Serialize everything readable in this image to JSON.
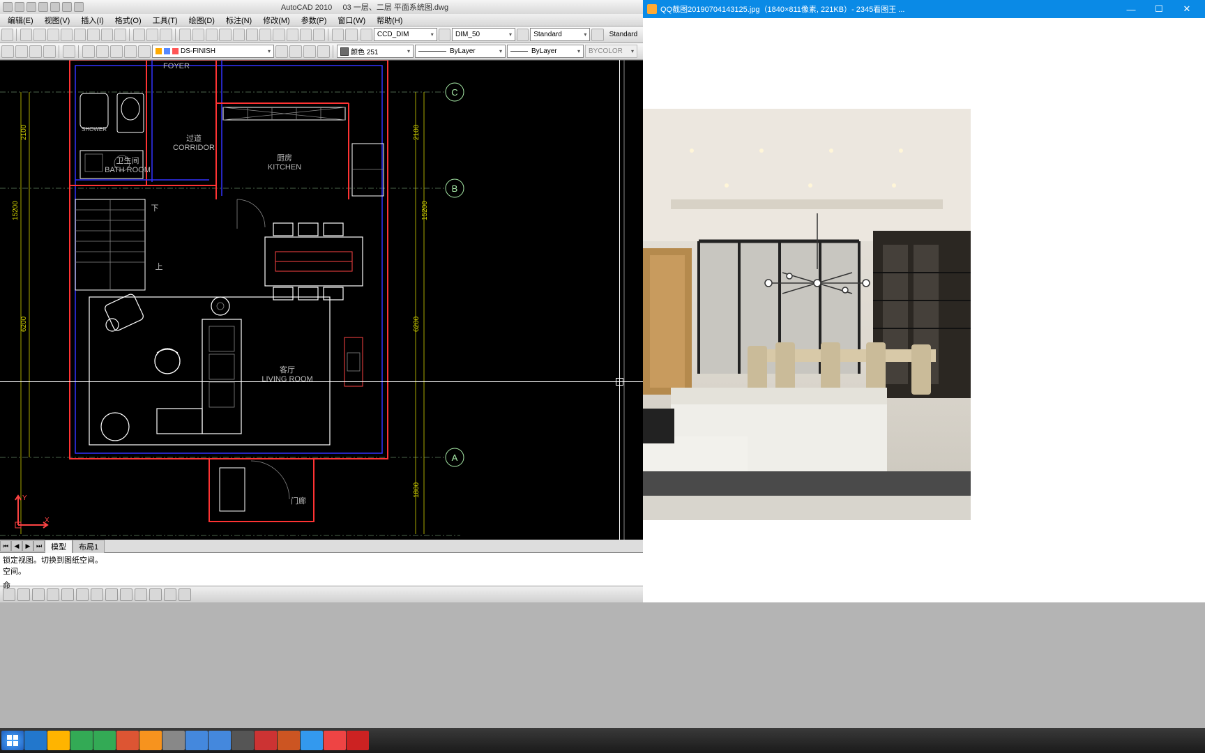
{
  "acad": {
    "app_name": "AutoCAD 2010",
    "filename": "03 一层、二层 平面系统图.dwg",
    "menus": [
      "编辑(E)",
      "视图(V)",
      "插入(I)",
      "格式(O)",
      "工具(T)",
      "绘图(D)",
      "标注(N)",
      "修改(M)",
      "参数(P)",
      "窗口(W)",
      "帮助(H)"
    ],
    "layer_dd": "DS-FINISH",
    "style_dd1": "CCD_DIM",
    "style_dd2": "DIM_50",
    "style_dd3": "Standard",
    "style_dd4": "Standard",
    "color_dd": "颜色 251",
    "lt_dd": "ByLayer",
    "lw_dd": "ByLayer",
    "plot_dd": "BYCOLOR",
    "tabs": {
      "active": "模型",
      "inactive": "布局1"
    },
    "cmd_history1": "锁定视图。切换到图纸空间。",
    "cmd_history2": "空间。",
    "cmd_prompt": "命",
    "rooms": {
      "foyer_cn": "",
      "foyer_en": "FOYER",
      "corridor_cn": "过道",
      "corridor_en": "CORRIDOR",
      "bath_cn": "卫生间",
      "bath_en": "BATH ROOM",
      "kitchen_cn": "厨房",
      "kitchen_en": "KITCHEN",
      "living_cn": "客厅",
      "living_en": "LIVING ROOM",
      "porch_cn": "门廊",
      "shower": "SHOWER",
      "down": "下",
      "up": "上"
    },
    "grids": {
      "a": "A",
      "b": "B",
      "c": "C"
    },
    "dims": {
      "d1": "2100",
      "d2": "15200",
      "d3": "6200",
      "d4": "1800"
    }
  },
  "viewer": {
    "title": "QQ截图20190704143125.jpg（1840×811像素, 221KB）- 2345看图王 ..."
  }
}
